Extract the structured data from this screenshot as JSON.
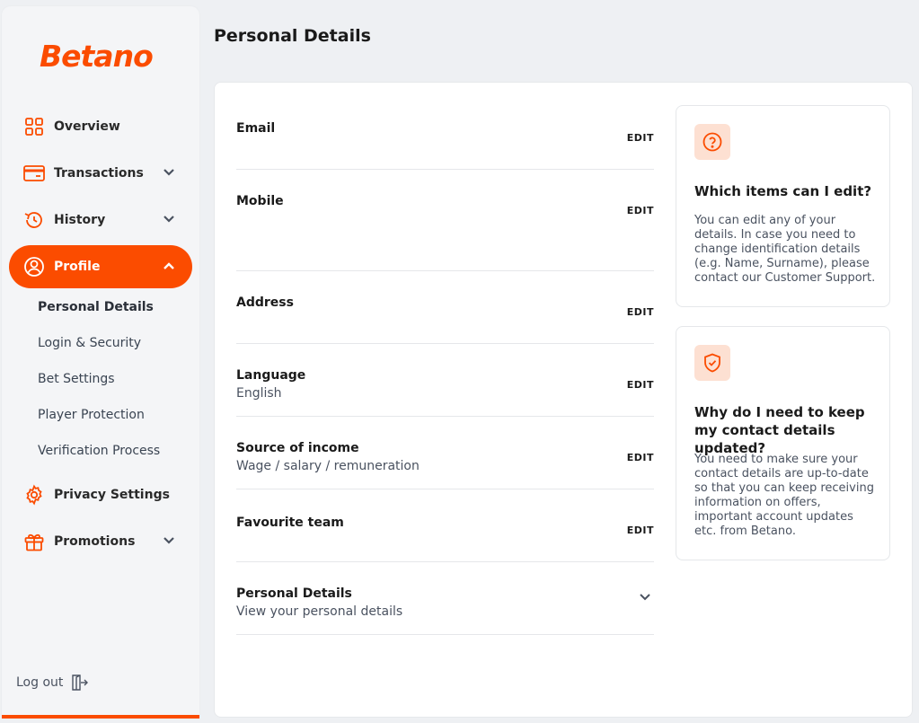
{
  "brand": {
    "logo_text": "Betano",
    "accent_color": "#fb4c00"
  },
  "sidebar": {
    "nav": [
      {
        "id": "overview",
        "label": "Overview",
        "icon": "grid-icon",
        "has_chevron": false
      },
      {
        "id": "transactions",
        "label": "Transactions",
        "icon": "credit-card-icon",
        "has_chevron": true
      },
      {
        "id": "history",
        "label": "History",
        "icon": "history-icon",
        "has_chevron": true
      },
      {
        "id": "profile",
        "label": "Profile",
        "icon": "user-circle-icon",
        "has_chevron": true,
        "active": true
      }
    ],
    "profile_sub": [
      {
        "label": "Personal Details",
        "current": true
      },
      {
        "label": "Login & Security"
      },
      {
        "label": "Bet Settings"
      },
      {
        "label": "Player Protection"
      },
      {
        "label": "Verification Process"
      }
    ],
    "nav_bottom": [
      {
        "id": "privacy",
        "label": "Privacy Settings",
        "icon": "gear-icon",
        "has_chevron": false
      },
      {
        "id": "promotions",
        "label": "Promotions",
        "icon": "gift-icon",
        "has_chevron": true
      }
    ],
    "logout_label": "Log out"
  },
  "page": {
    "title": "Personal Details"
  },
  "details": {
    "edit_label": "EDIT",
    "rows": [
      {
        "label": "Email",
        "value": ""
      },
      {
        "label": "Mobile",
        "value": ""
      },
      {
        "label": "Address",
        "value": ""
      },
      {
        "label": "Language",
        "value": "English"
      },
      {
        "label": "Source of income",
        "value": "Wage / salary / remuneration"
      },
      {
        "label": "Favourite team",
        "value": ""
      }
    ],
    "expand_row": {
      "label": "Personal Details",
      "value": "View your personal details"
    }
  },
  "info": [
    {
      "icon": "question-circle-icon",
      "title": "Which items can I edit?",
      "text": "You can edit any of your details. In case you need to change identification details (e.g. Name, Surname), please contact our Customer Support."
    },
    {
      "icon": "shield-check-icon",
      "title": "Why do I need to keep my contact details updated?",
      "text": "You need to make sure your contact details are up-to-date so that you can keep receiving information on offers, important account updates etc. from Betano."
    }
  ]
}
